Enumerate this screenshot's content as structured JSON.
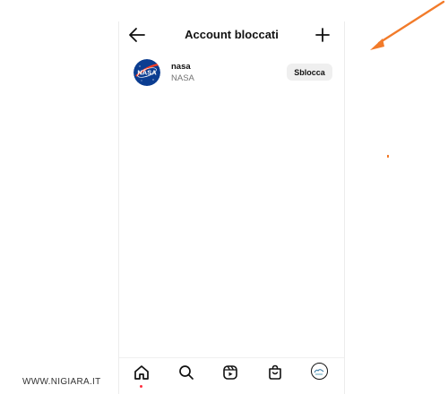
{
  "header": {
    "title": "Account bloccati",
    "back_icon": "arrow-left-icon",
    "add_icon": "plus-icon"
  },
  "blocked_accounts": [
    {
      "username": "nasa",
      "full_name": "NASA",
      "avatar_logo_text": "NASA",
      "action_label": "Sblocca"
    }
  ],
  "bottom_nav": {
    "items": [
      "home-icon",
      "search-icon",
      "reels-icon",
      "shop-icon",
      "profile-avatar"
    ],
    "active": "home-icon"
  },
  "watermark": "WWW.NIGIARA.IT",
  "colors": {
    "annotation_arrow": "#f27b2a",
    "nasa_blue": "#0b3d91",
    "nasa_red": "#fc3d21",
    "button_bg": "#efefef",
    "notification_dot": "#ff3040"
  }
}
